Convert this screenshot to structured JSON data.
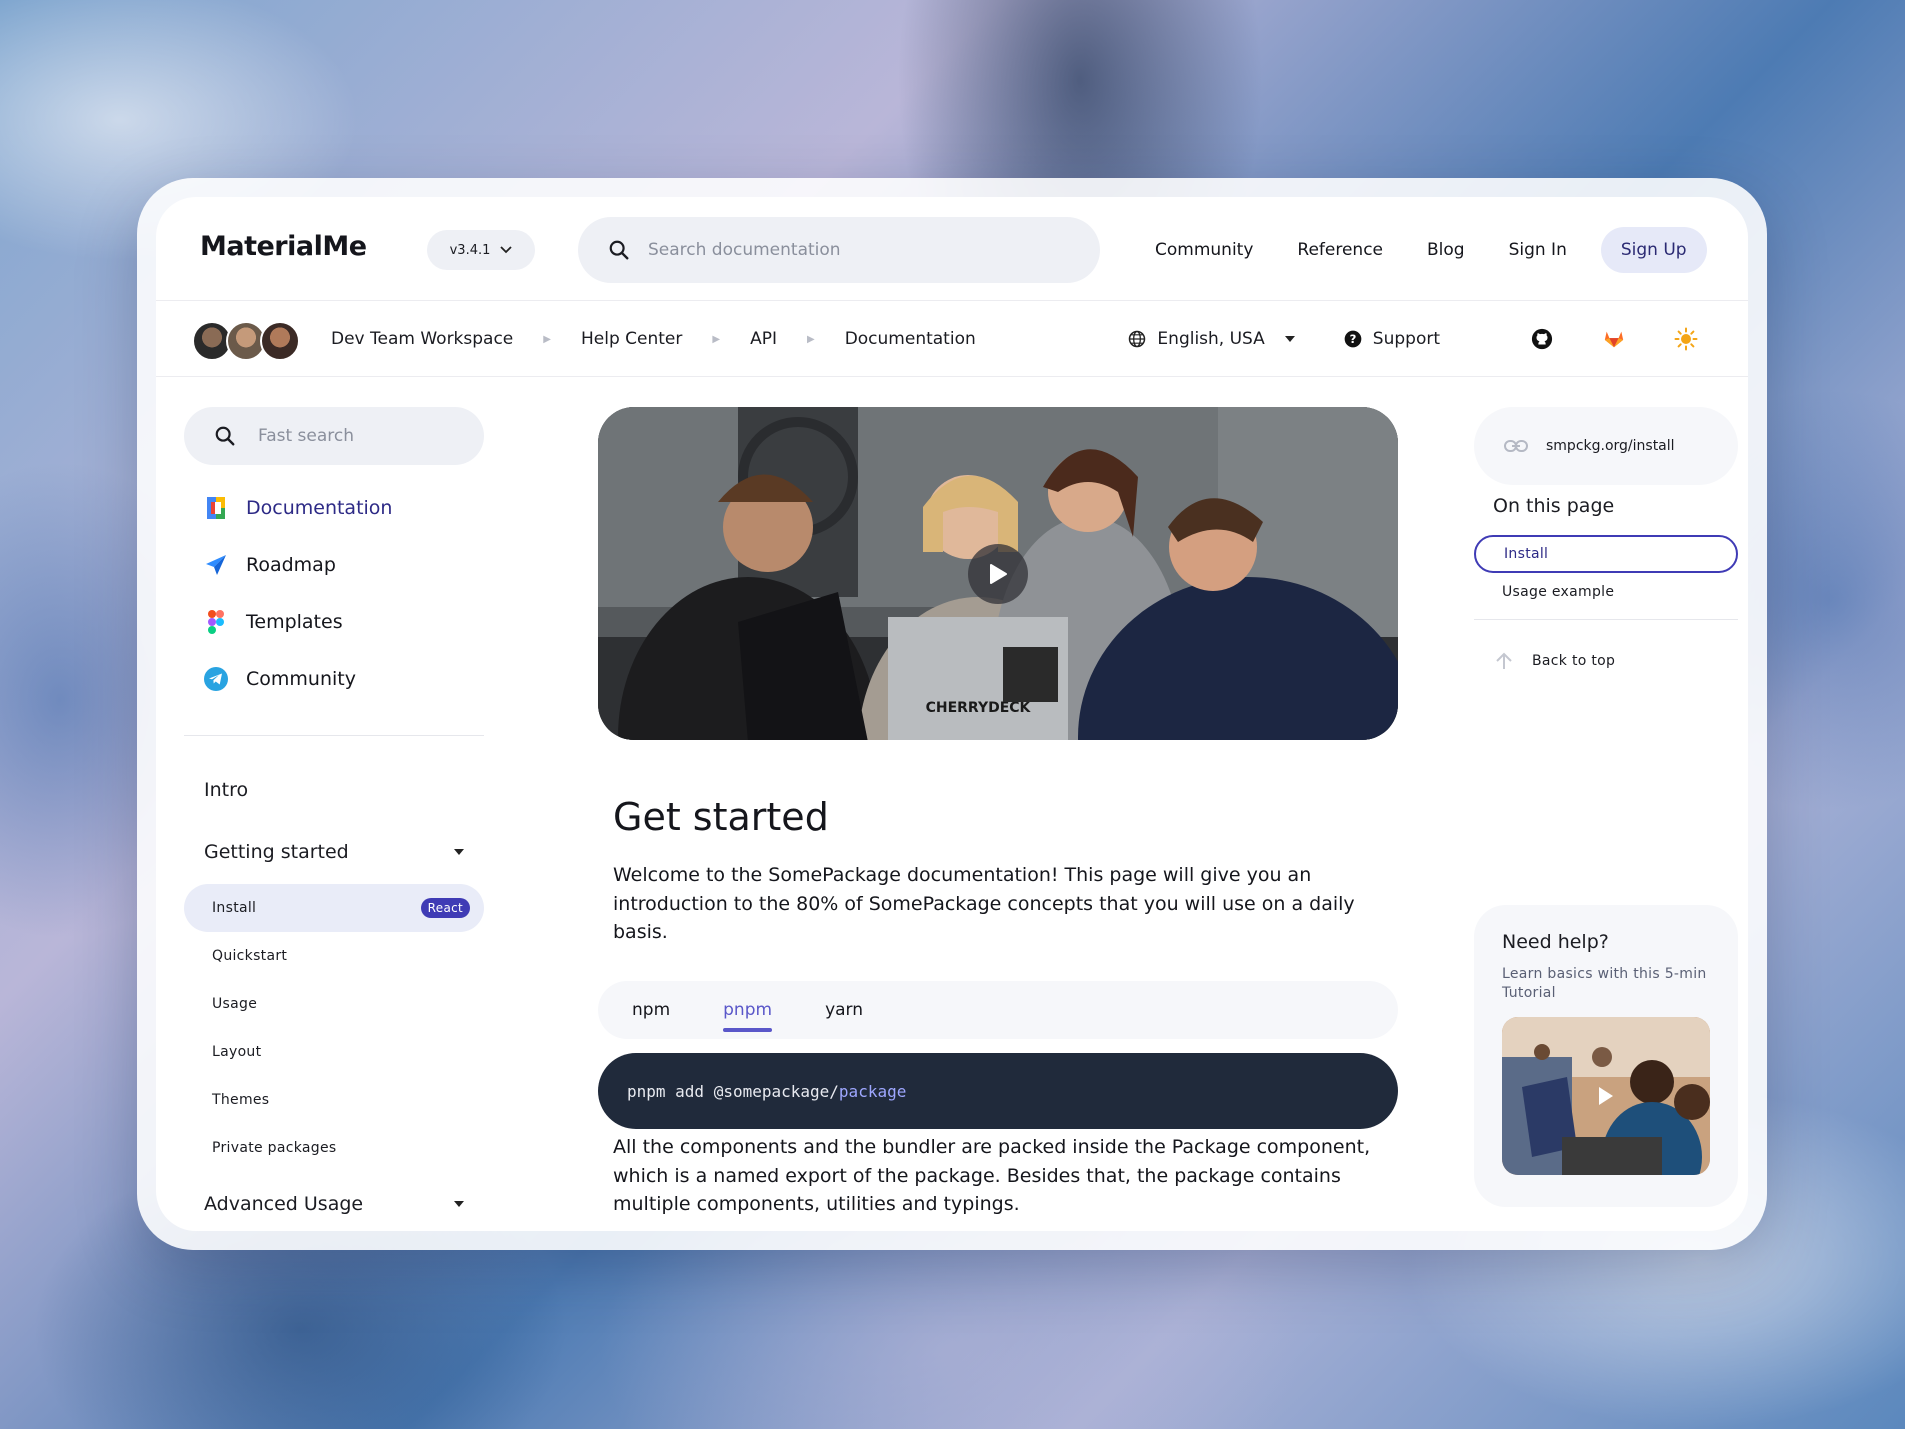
{
  "header": {
    "logo": "MaterialMe",
    "version": "v3.4.1",
    "search_placeholder": "Search documentation",
    "nav": [
      "Community",
      "Reference",
      "Blog",
      "Sign In"
    ],
    "signup_label": "Sign Up"
  },
  "subbar": {
    "breadcrumbs": [
      "Dev Team Workspace",
      "Help Center",
      "API",
      "Documentation"
    ],
    "language": "English, USA",
    "support_label": "Support"
  },
  "sidebar": {
    "search_placeholder": "Fast search",
    "primary": [
      {
        "label": "Documentation",
        "icon": "google-docs-icon",
        "active": true
      },
      {
        "label": "Roadmap",
        "icon": "send-icon"
      },
      {
        "label": "Templates",
        "icon": "figma-icon"
      },
      {
        "label": "Community",
        "icon": "telegram-icon"
      }
    ],
    "intro": "Intro",
    "getting_started": "Getting started",
    "sub_items": [
      {
        "label": "Install",
        "badge": "React",
        "active": true
      },
      {
        "label": "Quickstart"
      },
      {
        "label": "Usage"
      },
      {
        "label": "Layout"
      },
      {
        "label": "Themes"
      },
      {
        "label": "Private packages"
      }
    ],
    "advanced": "Advanced Usage"
  },
  "main": {
    "title": "Get started",
    "intro": "Welcome to the SomePackage documentation! This page will give you an introduction to the 80% of SomePackage concepts that you will use on a daily basis.",
    "tabs": [
      "npm",
      "pnpm",
      "yarn"
    ],
    "active_tab": "pnpm",
    "code_cmd": "pnpm add @somepackage/",
    "code_pkg": "package",
    "body": "All the components and the bundler are packed inside the Package component, which is a named export of the package. Besides that, the package contains multiple components, utilities and typings."
  },
  "right": {
    "url": "smpckg.org/install",
    "on_this_page": "On this page",
    "toc": [
      "Install",
      "Usage example"
    ],
    "back_to_top": "Back to top",
    "help_title": "Need help?",
    "help_sub": "Learn basics with this 5-min Tutorial"
  },
  "colors": {
    "accent": "#3f3bb5",
    "code_bg": "#202a3b",
    "tab_active": "#5a57c9"
  }
}
